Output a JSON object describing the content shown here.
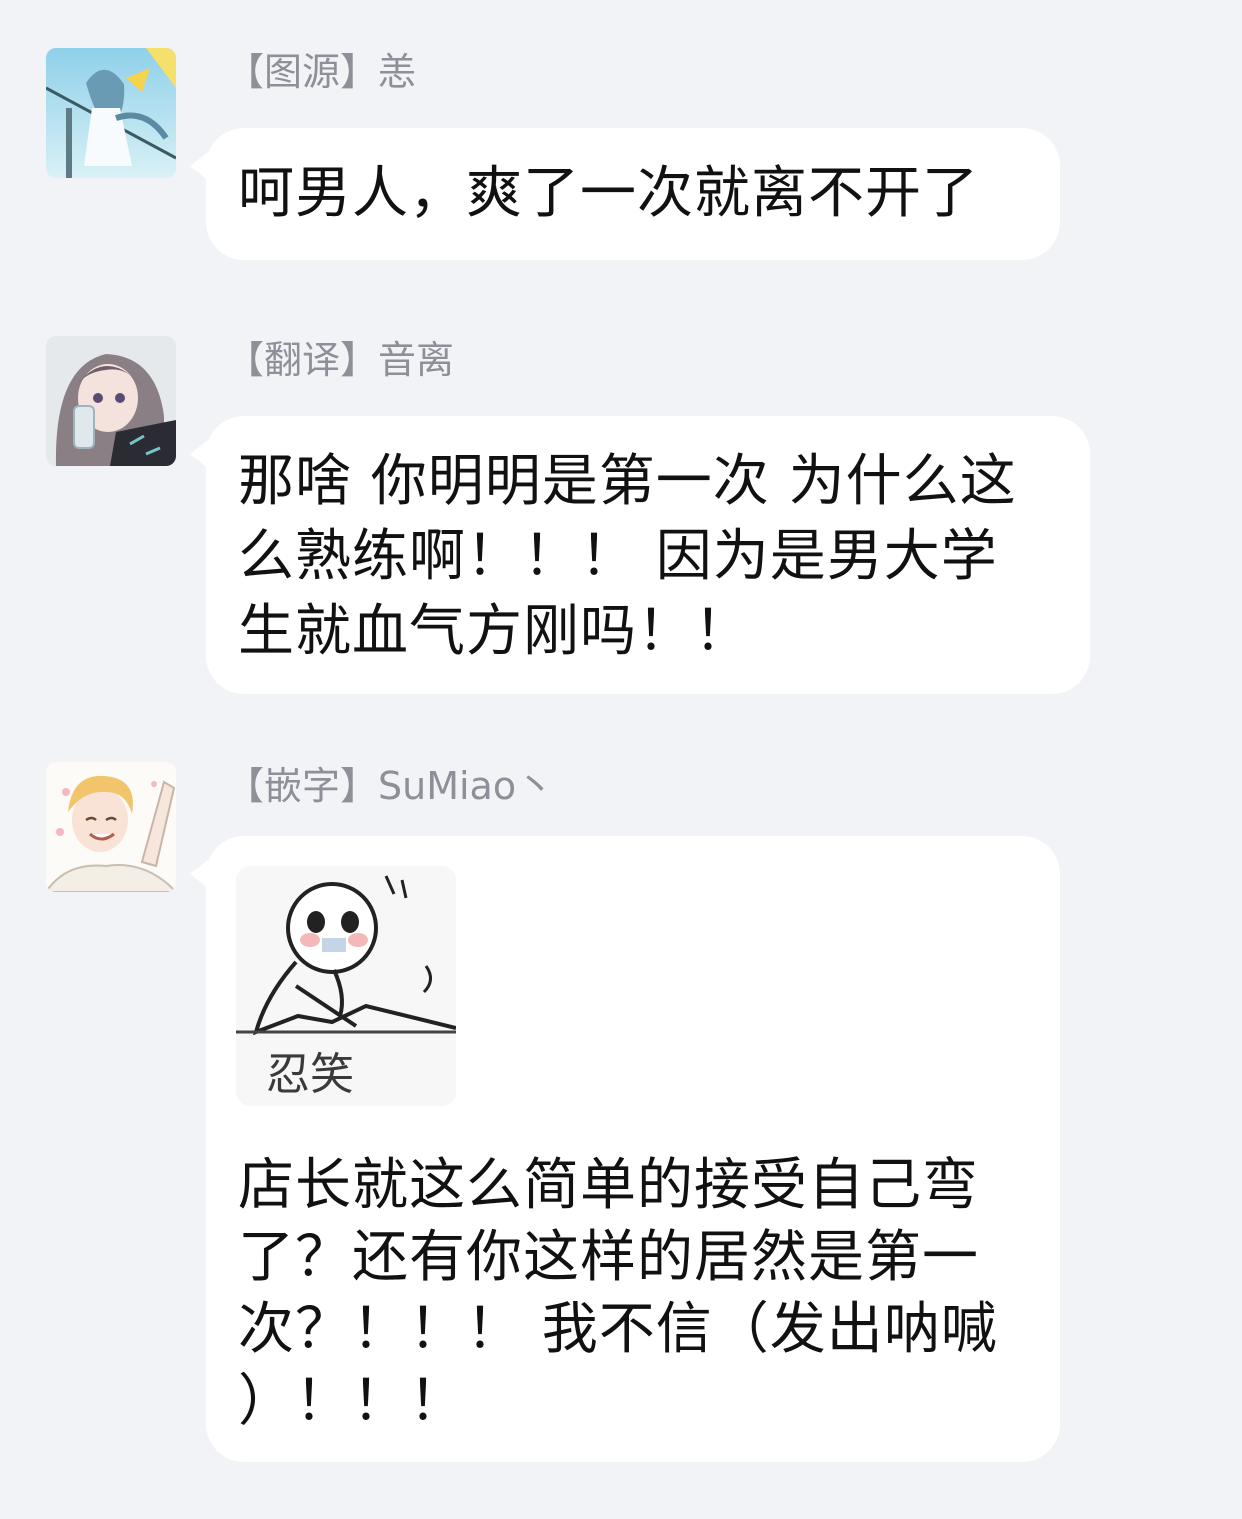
{
  "messages": [
    {
      "sender": "【图源】恙",
      "avatar_icon": "anime-girl-avatar",
      "lines": [
        "呵男人，爽了一次就离不开了"
      ]
    },
    {
      "sender": "【翻译】音离",
      "avatar_icon": "anime-girl-phone-avatar",
      "lines": [
        "那啥 你明明是第一次 为什么这",
        "么熟练啊！！！ 因为是男大学",
        "生就血气方刚吗！！"
      ]
    },
    {
      "sender": "【嵌字】SuMiao丶",
      "avatar_icon": "smiling-blond-boy-avatar",
      "sticker": {
        "icon": "holding-back-laugh-sticker",
        "caption": "忍笑"
      },
      "lines": [
        "店长就这么简单的接受自己弯",
        "了？还有你这样的居然是第一",
        "次？！！！ 我不信（发出呐喊",
        "）！！！"
      ]
    }
  ],
  "colors": {
    "background": "#f2f3f7",
    "bubble": "#ffffff",
    "sender_text": "#8e8f98",
    "message_text": "#111111"
  }
}
